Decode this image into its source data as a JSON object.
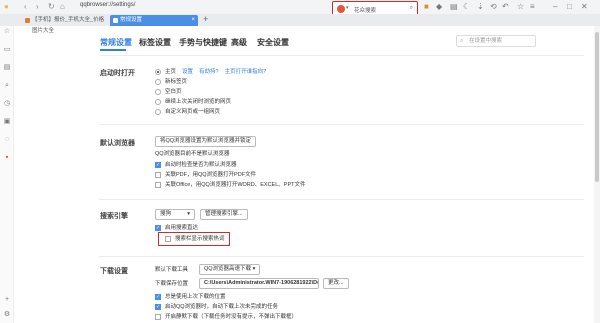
{
  "browser": {
    "url": "qqbrowser://settings/",
    "search_placeholder": "花众搜索",
    "tabs": [
      {
        "label": "【手机】报价_手机大全_价格图片大全"
      },
      {
        "label": "常规设置"
      }
    ],
    "new_tab": "+"
  },
  "settings_nav": {
    "tabs": [
      "常规设置",
      "标签设置",
      "手势与快捷键",
      "高级",
      "安全设置"
    ],
    "search_placeholder": "在设置中搜索"
  },
  "startup": {
    "label": "启动时打开",
    "options": [
      "主页",
      "新标签页",
      "空白页",
      "继续上次关闭时浏览的网页",
      "自定义网页或一组网页"
    ],
    "links": [
      "设置",
      "有劫持?",
      "主页打开谁指向?"
    ]
  },
  "default_browser": {
    "label": "默认浏览器",
    "button": "将QQ浏览器设置为默认浏览器并锁定",
    "status": "QQ浏览器目前不是默认浏览器",
    "checks": [
      {
        "label": "启动时检查是否为默认浏览器",
        "checked": true
      },
      {
        "label": "关联PDF，用QQ浏览器打开PDF文件",
        "checked": false
      },
      {
        "label": "关联Office，用QQ浏览器打开WORD、EXCEL、PPT文件",
        "checked": false
      }
    ]
  },
  "search_engine": {
    "label": "搜索引擎",
    "selected": "搜狗",
    "manage_button": "管理搜索引擎...",
    "checks": [
      {
        "label": "启用搜索直达",
        "checked": true
      },
      {
        "label": "搜索栏显示搜索热词",
        "checked": false
      }
    ]
  },
  "download": {
    "label": "下载设置",
    "tool_label": "默认下载工具",
    "tool_value": "QQ浏览器高速下载",
    "path_label": "下载保存位置",
    "path_value": "C:\\Users\\Administrator.WIN7-1906281922\\Deskt",
    "change_button": "更改...",
    "checks": [
      {
        "label": "总是使用上次下载的位置",
        "checked": true
      },
      {
        "label": "启动QQ浏览器时，自动下载上次未完成的任务",
        "checked": true
      },
      {
        "label": "开启静默下载（下载任务时没有提示，不弹出下载框）",
        "checked": false
      }
    ]
  },
  "colors": {
    "accent": "#2f7ee8",
    "highlight": "#d02a2a",
    "tab_active": "#4a8ee6"
  }
}
